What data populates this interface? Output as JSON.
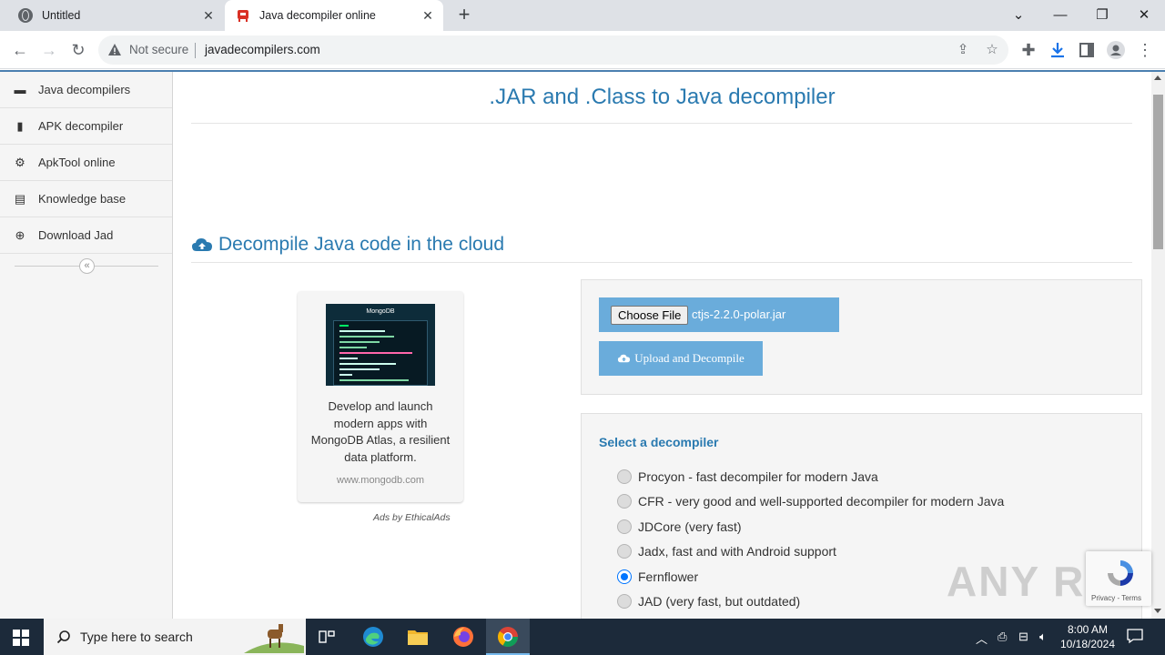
{
  "browser": {
    "tabs": [
      {
        "title": "Untitled",
        "active": false
      },
      {
        "title": "Java decompiler online",
        "active": true
      }
    ],
    "address": {
      "security_label": "Not secure",
      "url": "javadecompilers.com"
    }
  },
  "sidebar": {
    "items": [
      {
        "label": "Java decompilers",
        "icon": "laptop-icon"
      },
      {
        "label": "APK decompiler",
        "icon": "phone-icon"
      },
      {
        "label": "ApkTool online",
        "icon": "gear-icon"
      },
      {
        "label": "Knowledge base",
        "icon": "book-icon"
      },
      {
        "label": "Download Jad",
        "icon": "download-icon"
      }
    ],
    "collapse_glyph": "«"
  },
  "main": {
    "heading": ".JAR and .Class to Java decompiler",
    "section_heading": "Decompile Java code in the cloud",
    "ad": {
      "brand": "MongoDB",
      "text": "Develop and launch modern apps with MongoDB Atlas, a resilient data platform.",
      "url": "www.mongodb.com",
      "by": "Ads by EthicalAds"
    },
    "upload": {
      "choose_label": "Choose File",
      "file_name": "ctjs-2.2.0-polar.jar",
      "upload_label": "Upload and Decompile"
    },
    "decompiler": {
      "title": "Select a decompiler",
      "options": [
        {
          "label": "Procyon - fast decompiler for modern Java",
          "selected": false
        },
        {
          "label": "CFR - very good and well-supported decompiler for modern Java",
          "selected": false
        },
        {
          "label": "JDCore (very fast)",
          "selected": false
        },
        {
          "label": "Jadx, fast and with Android support",
          "selected": false
        },
        {
          "label": "Fernflower",
          "selected": true
        },
        {
          "label": "JAD (very fast, but outdated)",
          "selected": false
        }
      ]
    }
  },
  "recaptcha": {
    "terms": "Privacy - Terms"
  },
  "watermark": "ANY RUN",
  "taskbar": {
    "search_placeholder": "Type here to search",
    "time": "8:00 AM",
    "date": "10/18/2024"
  },
  "colors": {
    "accent": "#2a7ab0",
    "button": "#6aacdb",
    "taskbar": "#1c2a3a"
  }
}
